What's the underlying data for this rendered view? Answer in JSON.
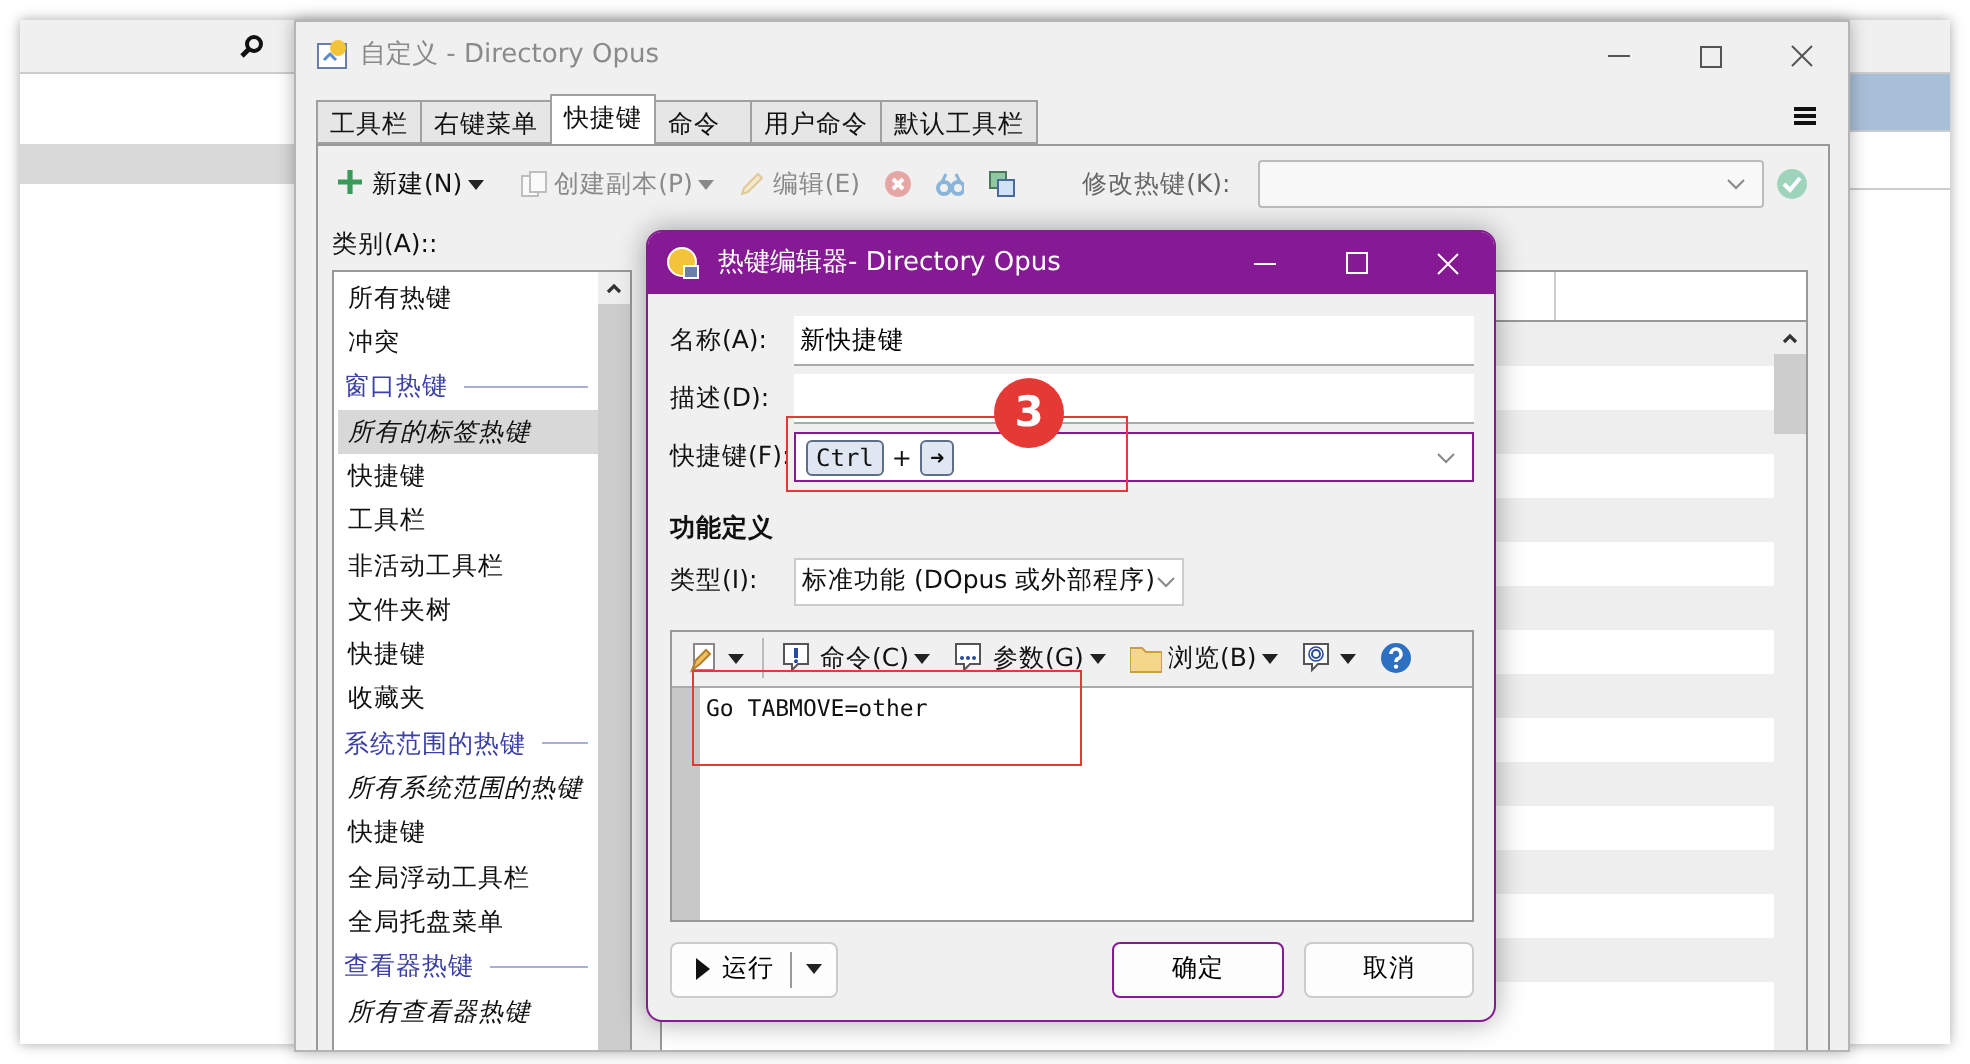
{
  "customize_window": {
    "title": "自定义 - Directory Opus",
    "tabs": [
      {
        "label": "工具栏",
        "selected": false
      },
      {
        "label": "右键菜单",
        "selected": false
      },
      {
        "label": "快捷键",
        "selected": true
      },
      {
        "label": "命令",
        "selected": false
      },
      {
        "label": "用户命令",
        "selected": false
      },
      {
        "label": "默认工具栏",
        "selected": false
      }
    ],
    "toolbar": [
      {
        "kind": "new",
        "label": "新建(N)",
        "disabled": false
      },
      {
        "kind": "duplicate",
        "label": "创建副本(P)",
        "disabled": true
      },
      {
        "kind": "edit",
        "label": "编辑(E)",
        "disabled": true
      },
      {
        "kind": "delete",
        "disabled": true
      },
      {
        "kind": "find",
        "disabled": true
      },
      {
        "kind": "clone",
        "disabled": false
      }
    ],
    "hotkey_change_label": "修改热键(K):",
    "category_label": "类别(A)::",
    "categories": [
      {
        "kind": "item",
        "label": "所有热键",
        "selected": false
      },
      {
        "kind": "item",
        "label": "冲突",
        "selected": false
      },
      {
        "kind": "group",
        "label": "窗口热键",
        "selected": false
      },
      {
        "kind": "all",
        "label": "所有的标签热键",
        "selected": true
      },
      {
        "kind": "item",
        "label": "快捷键",
        "selected": false
      },
      {
        "kind": "item",
        "label": "工具栏",
        "selected": false
      },
      {
        "kind": "item",
        "label": "非活动工具栏",
        "selected": false
      },
      {
        "kind": "item",
        "label": "文件夹树",
        "selected": false
      },
      {
        "kind": "item",
        "label": "快捷键",
        "selected": false
      },
      {
        "kind": "item",
        "label": "收藏夹",
        "selected": false
      },
      {
        "kind": "group",
        "label": "系统范围的热键",
        "selected": false
      },
      {
        "kind": "all",
        "label": "所有系统范围的热键",
        "selected": false
      },
      {
        "kind": "item",
        "label": "快捷键",
        "selected": false
      },
      {
        "kind": "item",
        "label": "全局浮动工具栏",
        "selected": false
      },
      {
        "kind": "item",
        "label": "全局托盘菜单",
        "selected": false
      },
      {
        "kind": "group",
        "label": "查看器热键",
        "selected": false
      },
      {
        "kind": "all",
        "label": "所有查看器热键",
        "selected": false
      }
    ]
  },
  "hotkey_editor": {
    "title": "热键编辑器- Directory Opus",
    "fields": [
      {
        "label": "名称(A):",
        "value": "新快捷键"
      },
      {
        "label": "描述(D):"
      }
    ],
    "hotkey": {
      "label": "快捷键(F):",
      "parts": [
        {
          "kind": "key",
          "text": "Ctrl"
        },
        {
          "kind": "plus",
          "text": "+"
        },
        {
          "kind": "key",
          "text": "➜"
        }
      ]
    },
    "section_title": "功能定义",
    "type": {
      "label": "类型(I):",
      "value": "标准功能 (DOpus 或外部程序)"
    },
    "editor_toolbar": [
      {
        "kind": "new"
      },
      {
        "kind": "command",
        "label": "命令(C)"
      },
      {
        "kind": "arguments",
        "label": "参数(G)"
      },
      {
        "kind": "browse",
        "label": "浏览(B)"
      },
      {
        "kind": "insert"
      },
      {
        "kind": "help"
      }
    ],
    "code": "Go TABMOVE=other",
    "run_label": "运行",
    "ok_label": "确定",
    "cancel_label": "取消"
  },
  "annotation": {
    "badge": "3"
  }
}
